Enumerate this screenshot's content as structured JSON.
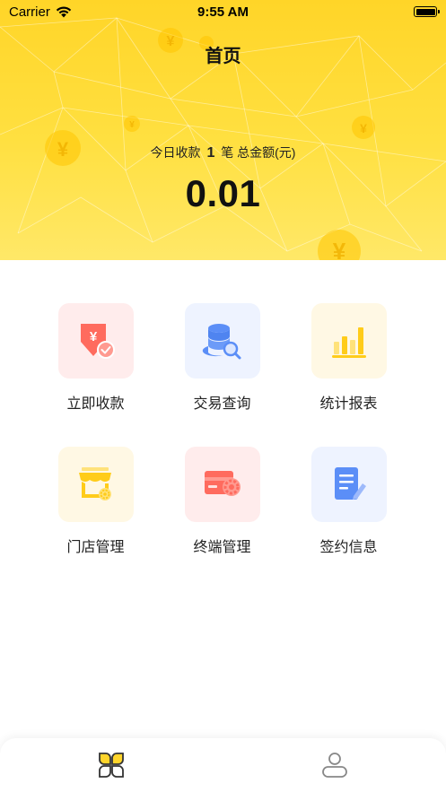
{
  "status_bar": {
    "carrier": "Carrier",
    "time": "9:55 AM"
  },
  "header": {
    "title": "首页",
    "summary_prefix": "今日收款",
    "count": "1",
    "summary_suffix": "笔 总金额(元)",
    "amount": "0.01"
  },
  "menu": [
    {
      "label": "立即收款",
      "icon": "receive-payment-icon"
    },
    {
      "label": "交易查询",
      "icon": "transaction-search-icon"
    },
    {
      "label": "统计报表",
      "icon": "bar-chart-icon"
    },
    {
      "label": "门店管理",
      "icon": "store-settings-icon"
    },
    {
      "label": "终端管理",
      "icon": "terminal-settings-icon"
    },
    {
      "label": "签约信息",
      "icon": "contract-edit-icon"
    }
  ],
  "tabbar": {
    "tabs": [
      {
        "icon": "home-grid-icon",
        "active": true
      },
      {
        "icon": "profile-icon",
        "active": false
      }
    ]
  },
  "colors": {
    "accent_yellow": "#ffd52b",
    "icon_red": "#ff6b5e",
    "icon_blue": "#5b8ef7",
    "icon_yellow": "#ffcc1a"
  }
}
